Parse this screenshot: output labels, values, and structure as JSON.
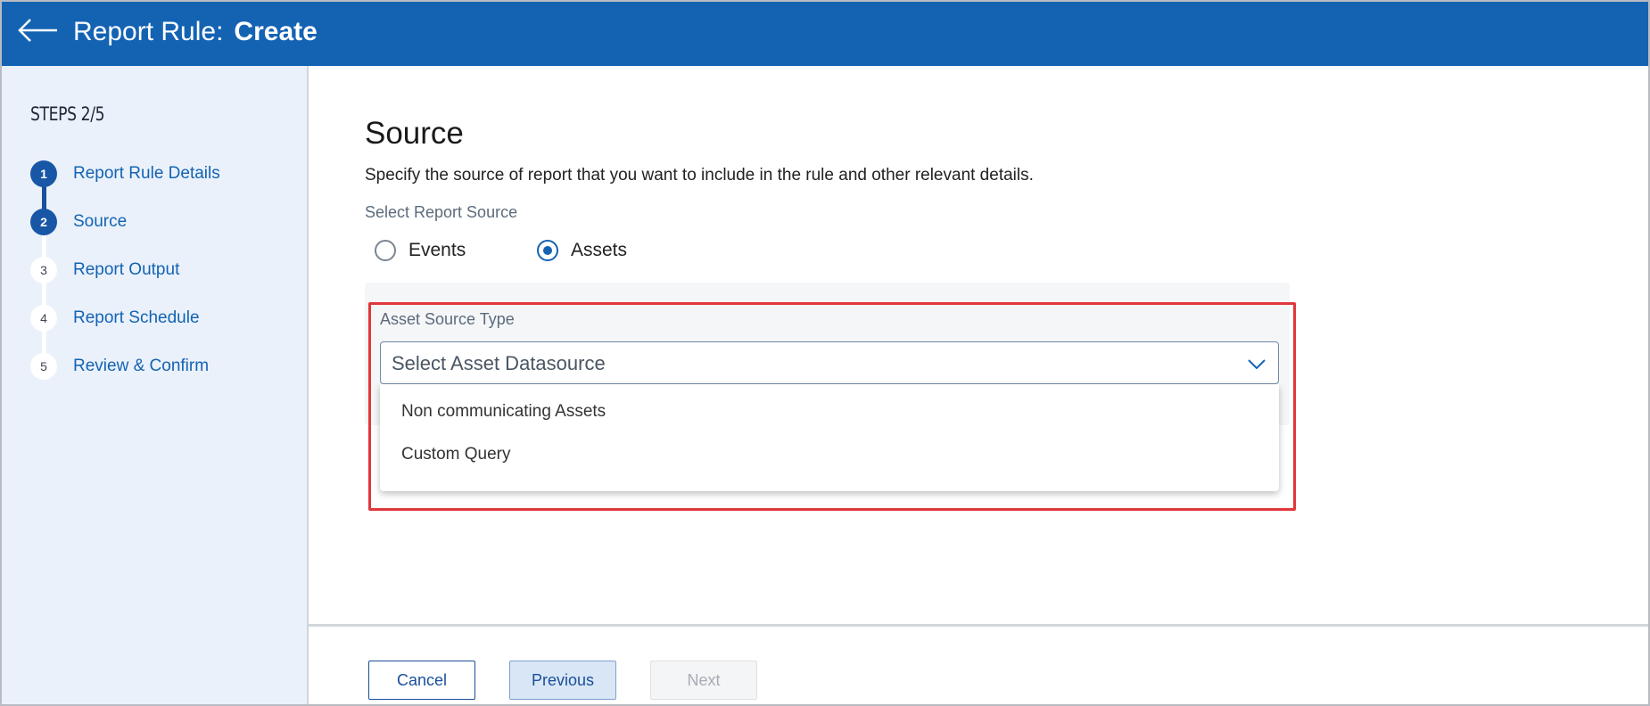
{
  "header": {
    "title_prefix": "Report Rule:",
    "title_mode": "Create",
    "back_icon": "arrow-left-icon"
  },
  "sidebar": {
    "steps_heading": "STEPS 2/5",
    "steps": [
      {
        "number": "1",
        "label": "Report Rule Details",
        "status": "completed"
      },
      {
        "number": "2",
        "label": "Source",
        "status": "current"
      },
      {
        "number": "3",
        "label": "Report Output",
        "status": "pending"
      },
      {
        "number": "4",
        "label": "Report Schedule",
        "status": "pending"
      },
      {
        "number": "5",
        "label": "Review & Confirm",
        "status": "pending"
      }
    ]
  },
  "main": {
    "title": "Source",
    "description": "Specify the source of report that you want to include in the rule and other relevant details.",
    "report_source": {
      "label": "Select Report Source",
      "options": [
        {
          "label": "Events",
          "checked": false
        },
        {
          "label": "Assets",
          "checked": true
        }
      ]
    },
    "asset_source": {
      "label": "Asset Source Type",
      "placeholder": "Select Asset Datasource",
      "options": [
        "Non communicating Assets",
        "Custom Query"
      ]
    }
  },
  "footer": {
    "cancel_label": "Cancel",
    "previous_label": "Previous",
    "next_label": "Next"
  },
  "colors": {
    "header_bg": "#1463b3",
    "sidebar_bg": "#eaf1fa",
    "accent": "#1757a6",
    "highlight": "#e0373a"
  }
}
